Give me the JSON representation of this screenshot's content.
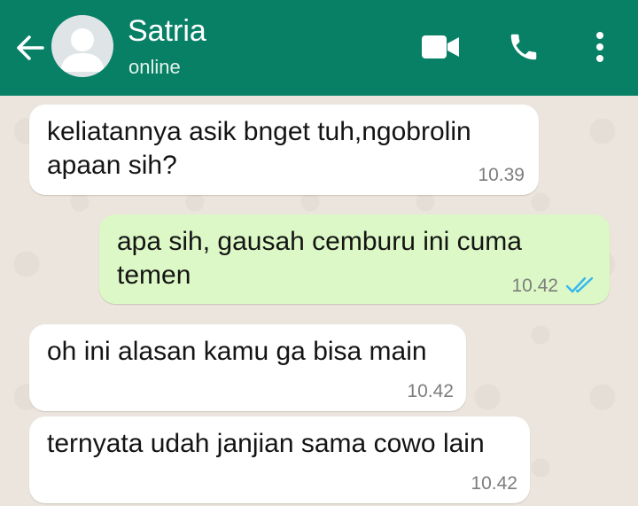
{
  "header": {
    "contact_name": "Satria",
    "status": "online",
    "background_color": "#078066",
    "icons": [
      "back-arrow-icon",
      "avatar-placeholder",
      "video-camera-icon",
      "phone-icon",
      "more-vertical-icon"
    ]
  },
  "messages": [
    {
      "direction": "incoming",
      "text": "keliatannya asik bnget tuh,ngobrolin\napaan sih?",
      "time": "10.39"
    },
    {
      "direction": "outgoing",
      "text": "apa sih, gausah cemburu ini cuma\ntemen",
      "time": "10.42",
      "status": "read"
    },
    {
      "direction": "incoming",
      "text": "oh ini alasan kamu ga bisa main",
      "time": "10.42"
    },
    {
      "direction": "incoming",
      "text": "ternyata udah janjian sama cowo lain",
      "time": "10.42"
    }
  ],
  "colors": {
    "incoming_bubble": "#ffffff",
    "outgoing_bubble": "#dcf8c6",
    "read_ticks": "#34b7f1",
    "chat_background": "#ece5dd"
  }
}
